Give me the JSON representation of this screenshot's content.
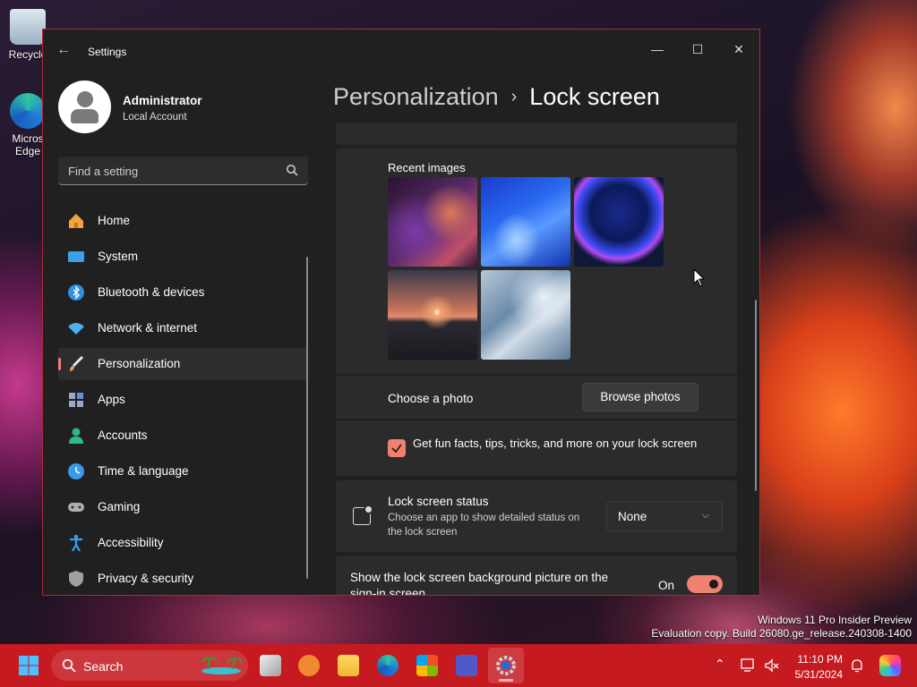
{
  "desktop": {
    "icons": [
      {
        "label": "Recycle"
      },
      {
        "label": "Micros Edge"
      }
    ],
    "watermark": [
      "Windows 11 Pro Insider Preview",
      "Evaluation copy. Build 26080.ge_release.240308-1400"
    ]
  },
  "window": {
    "title": "Settings",
    "back_glyph": "←",
    "controls": {
      "minimize": "—",
      "maximize": "☐",
      "close": "✕"
    }
  },
  "user": {
    "name": "Administrator",
    "type": "Local Account"
  },
  "search": {
    "placeholder": "Find a setting"
  },
  "nav": [
    {
      "label": "Home",
      "icon": "home-icon",
      "color": "#f2a33a"
    },
    {
      "label": "System",
      "icon": "system-icon",
      "color": "#3aa0e8"
    },
    {
      "label": "Bluetooth & devices",
      "icon": "bluetooth-icon",
      "color": "#2f8fe0"
    },
    {
      "label": "Network & internet",
      "icon": "wifi-icon",
      "color": "#4fb0f0"
    },
    {
      "label": "Personalization",
      "icon": "brush-icon",
      "color": "#e8a070",
      "active": true
    },
    {
      "label": "Apps",
      "icon": "apps-icon",
      "color": "#9aa8c8"
    },
    {
      "label": "Accounts",
      "icon": "person-icon",
      "color": "#2fb890"
    },
    {
      "label": "Time & language",
      "icon": "globe-clock-icon",
      "color": "#3a9ae8"
    },
    {
      "label": "Gaming",
      "icon": "controller-icon",
      "color": "#b0b0b0"
    },
    {
      "label": "Accessibility",
      "icon": "accessibility-icon",
      "color": "#3aa0f0"
    },
    {
      "label": "Privacy & security",
      "icon": "shield-icon",
      "color": "#a0a0a0"
    }
  ],
  "breadcrumb": {
    "parent": "Personalization",
    "separator": "›",
    "current": "Lock screen"
  },
  "recent_images": {
    "label": "Recent images",
    "thumbs": [
      "purple-swirl",
      "blue-bloom",
      "dark-blue-glow",
      "sunset-lake",
      "light-blue-bloom"
    ]
  },
  "choose_photo": {
    "label": "Choose a photo",
    "button": "Browse photos"
  },
  "fun_facts": {
    "label": "Get fun facts, tips, tricks, and more on your lock screen",
    "checked": true
  },
  "lock_status": {
    "title": "Lock screen status",
    "description": "Choose an app to show detailed status on the lock screen",
    "value": "None",
    "chevron": "⌵"
  },
  "signin_background": {
    "label": "Show the lock screen background picture on the sign-in screen",
    "state": "On",
    "on": true
  },
  "taskbar": {
    "search_label": "Search",
    "time": "11:10 PM",
    "date": "5/31/2024",
    "tray_chevron": "⌃"
  },
  "colors": {
    "accent": "#f08070",
    "taskbar": "#c41a20",
    "window_border": "#b02832"
  }
}
